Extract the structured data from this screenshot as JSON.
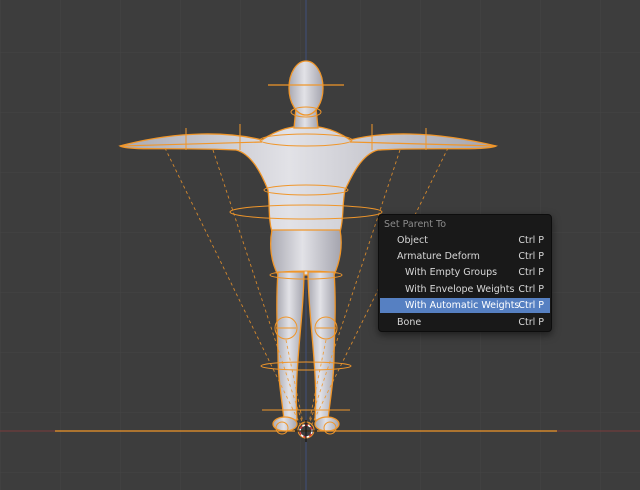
{
  "popup_menu": {
    "title": "Set Parent To",
    "items": [
      {
        "label": "Object",
        "shortcut": "Ctrl P",
        "indent": false,
        "active": false
      },
      {
        "label": "Armature Deform",
        "shortcut": "Ctrl P",
        "indent": false,
        "active": false
      },
      {
        "label": "With Empty Groups",
        "shortcut": "Ctrl P",
        "indent": true,
        "active": false
      },
      {
        "label": "With Envelope Weights",
        "shortcut": "Ctrl P",
        "indent": true,
        "active": false
      },
      {
        "label": "With Automatic Weights",
        "shortcut": "Ctrl P",
        "indent": true,
        "active": true
      },
      {
        "label": "Bone",
        "shortcut": "Ctrl P",
        "indent": false,
        "active": false
      }
    ]
  },
  "colors": {
    "viewport_bg": "#3d3d3d",
    "grid": "#454545",
    "armature_orange": "#f0962a",
    "mesh": "#c9c9cf",
    "menu_bg": "#191919",
    "menu_highlight": "#5680c2"
  }
}
